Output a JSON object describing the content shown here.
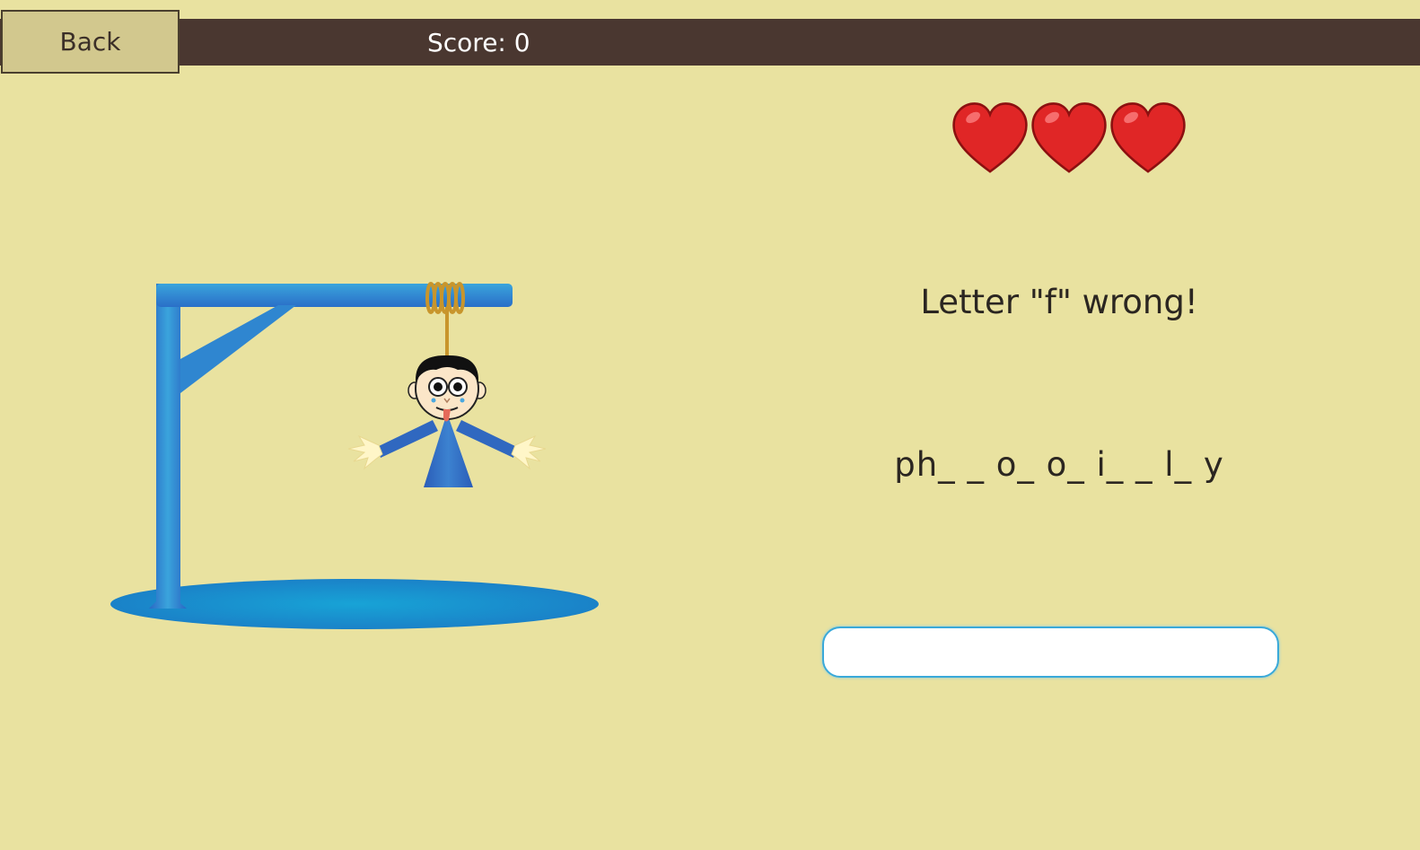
{
  "header": {
    "back_label": "Back",
    "score_label": "Score: 0"
  },
  "game": {
    "lives": 3,
    "message": "Letter \"f\" wrong!",
    "word_pattern": "ph_ _ o_ o_ i_ _ l_ y",
    "guess_input": {
      "value": "",
      "placeholder": ""
    }
  },
  "colors": {
    "background": "#e9e2a0",
    "top_bar": "#4a3730",
    "back_button": "#d2c88e",
    "gallows": "#2f8fd0",
    "heart": "#e02626",
    "input_border": "#3aa9d9"
  },
  "icons": {
    "life": "heart-icon",
    "gallows": "gallows-icon",
    "figure": "hangman-figure-icon"
  }
}
